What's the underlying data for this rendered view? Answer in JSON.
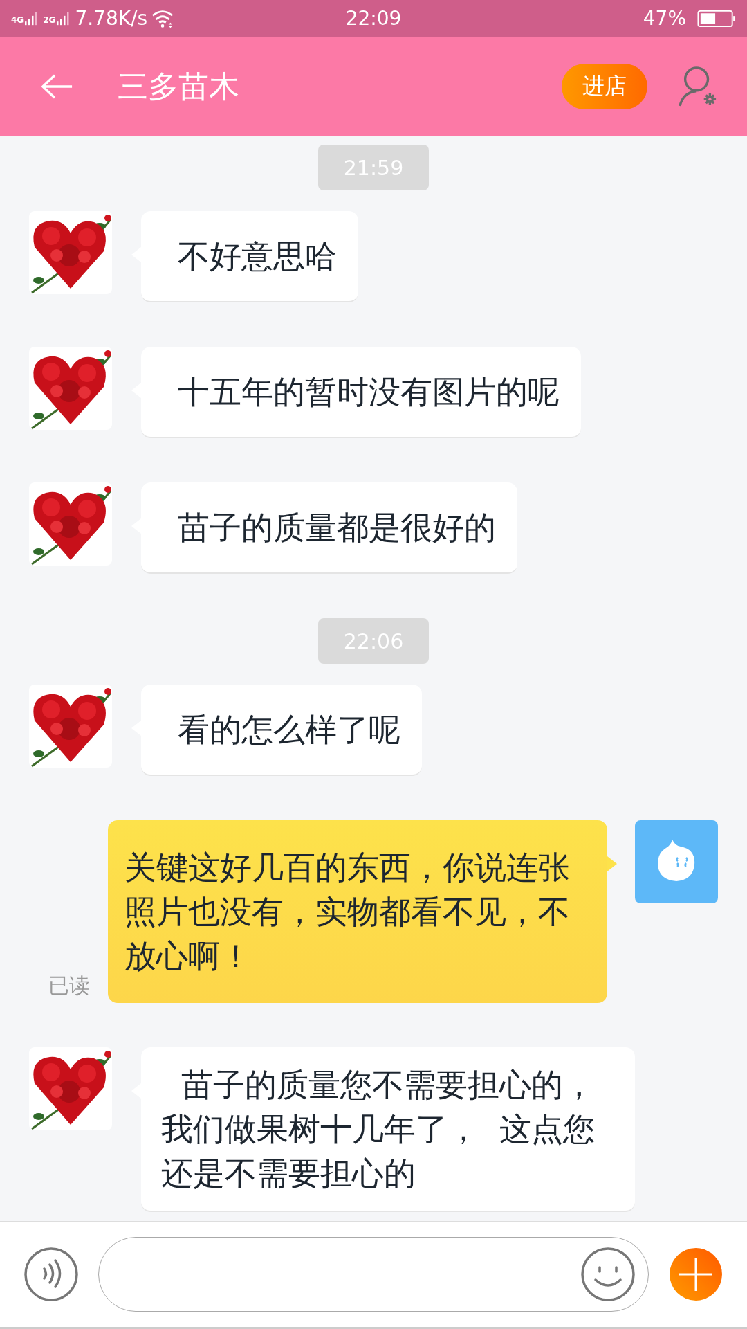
{
  "status_bar": {
    "sim_1": "4G",
    "sim_2": "2G",
    "speed": "7.78K/s",
    "time": "22:09",
    "battery": "47%"
  },
  "header": {
    "title": "三多苗木",
    "shop_button": "进店"
  },
  "messages": [
    {
      "kind": "time",
      "text": "21:59"
    },
    {
      "kind": "received",
      "text": "不好意思哈"
    },
    {
      "kind": "received",
      "text": "十五年的暂时没有图片的呢"
    },
    {
      "kind": "received",
      "text": "苗子的质量都是很好的"
    },
    {
      "kind": "time",
      "text": "22:06"
    },
    {
      "kind": "received",
      "text": "看的怎么样了呢"
    },
    {
      "kind": "sent",
      "text": "关键这好几百的东西，你说连张照片也没有，实物都看不见，不放心啊！",
      "receipt": "已读"
    },
    {
      "kind": "received",
      "text": "  苗子的质量您不需要担心的，我们做果树十几年了，  这点您还是不需要担心的"
    }
  ]
}
